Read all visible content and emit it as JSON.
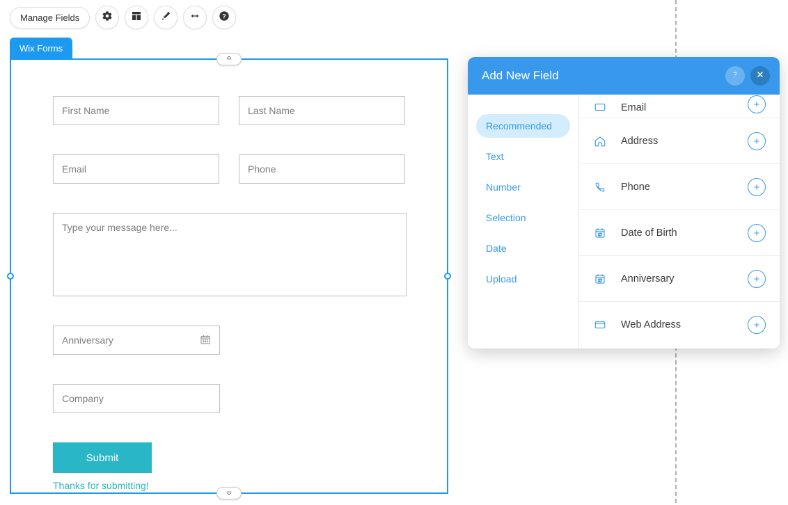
{
  "toolbar": {
    "manage_fields": "Manage Fields"
  },
  "tab": {
    "label": "Wix Forms"
  },
  "form": {
    "first_name": "First Name",
    "last_name": "Last Name",
    "email": "Email",
    "phone": "Phone",
    "message_placeholder": "Type your message here...",
    "anniversary": "Anniversary",
    "company": "Company",
    "submit": "Submit",
    "thanks": "Thanks for submitting!"
  },
  "panel": {
    "title": "Add New Field",
    "categories": [
      "Recommended",
      "Text",
      "Number",
      "Selection",
      "Date",
      "Upload"
    ],
    "fields": [
      {
        "label": "Email"
      },
      {
        "label": "Address"
      },
      {
        "label": "Phone"
      },
      {
        "label": "Date of Birth"
      },
      {
        "label": "Anniversary"
      },
      {
        "label": "Web Address"
      }
    ]
  }
}
